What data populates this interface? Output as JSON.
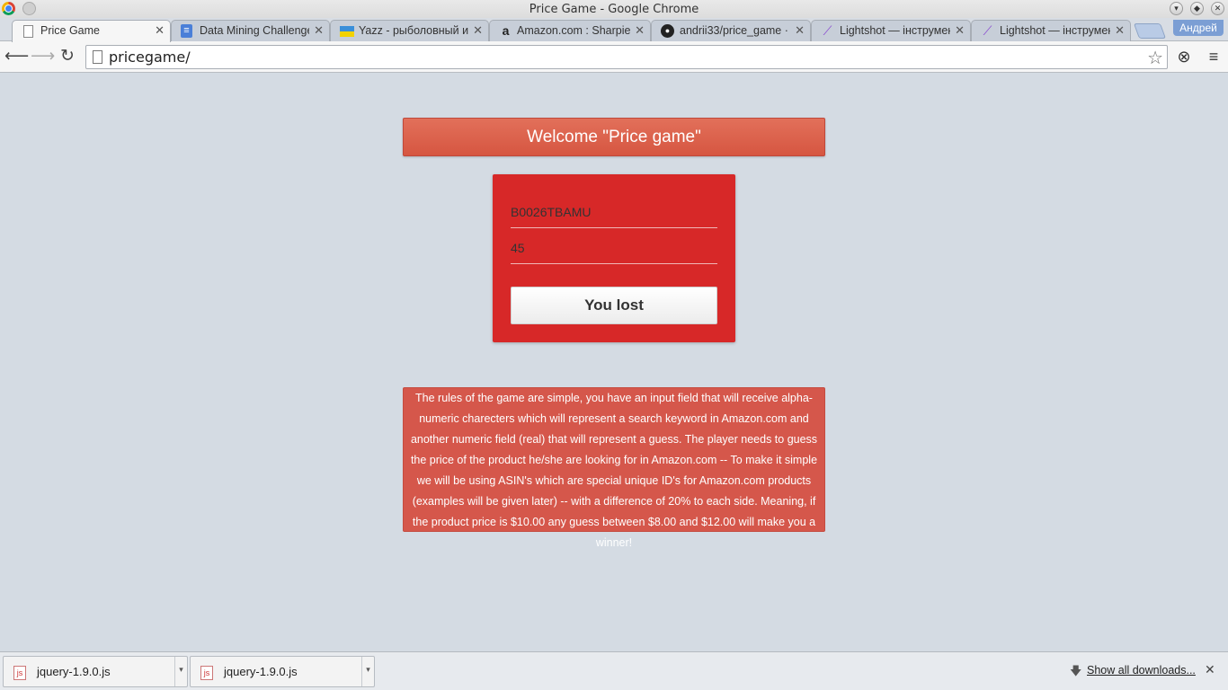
{
  "window": {
    "title": "Price Game - Google Chrome"
  },
  "tabs": [
    {
      "label": "Price Game",
      "icon": "page-icon",
      "active": true
    },
    {
      "label": "Data Mining Challenge",
      "icon": "docs-icon"
    },
    {
      "label": "Yazz - рыболовный ин",
      "icon": "yazz-icon"
    },
    {
      "label": "Amazon.com : Sharpie",
      "icon": "amazon-icon"
    },
    {
      "label": "andrii33/price_game ·",
      "icon": "github-icon"
    },
    {
      "label": "Lightshot — інструмен",
      "icon": "feather-icon"
    },
    {
      "label": "Lightshot — інструмен",
      "icon": "feather-icon"
    }
  ],
  "profile": {
    "name": "Андрей"
  },
  "omnibox": {
    "url": "pricegame/"
  },
  "content": {
    "welcome": "Welcome \"Price game\"",
    "asin_value": "B0026TBAMU",
    "price_value": "45",
    "result_button": "You lost",
    "rules_text": "The rules of the game are simple, you have an input field that will receive alpha-numeric charecters which will represent a search keyword in Amazon.com and another numeric field (real) that will represent a guess. The player needs to guess the price of the product he/she are looking for in Amazon.com -- To make it simple we will be using ASIN's which are special unique ID's for Amazon.com products (examples will be given later) -- with a difference of 20% to each side. Meaning, if the product price is $10.00 any guess between $8.00 and $12.00 will make you a winner!"
  },
  "downloads": {
    "items": [
      {
        "name": "jquery-1.9.0.js",
        "icon": "js-file-icon"
      },
      {
        "name": "jquery-1.9.0.js",
        "icon": "js-file-icon"
      }
    ],
    "show_all": "Show all downloads..."
  },
  "colors": {
    "background": "#d4dbe3",
    "welcome_bar": "#d9604c",
    "card": "#d72828",
    "rules_box": "#d5574b"
  }
}
